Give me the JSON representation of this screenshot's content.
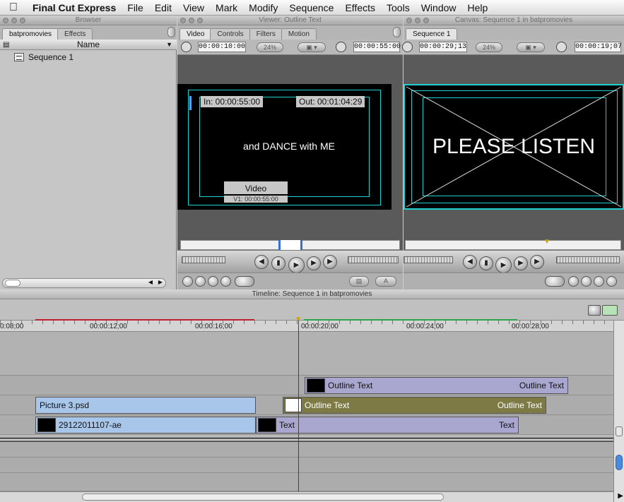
{
  "menubar": {
    "apple": "",
    "items": [
      "Final Cut Express",
      "File",
      "Edit",
      "View",
      "Mark",
      "Modify",
      "Sequence",
      "Effects",
      "Tools",
      "Window",
      "Help"
    ]
  },
  "browser": {
    "title": "Browser",
    "tabs": [
      "batpromovies",
      "Effects"
    ],
    "column_header": "Name",
    "items": [
      {
        "label": "Sequence 1"
      }
    ]
  },
  "viewer": {
    "title": "Viewer: Outline Text",
    "tabs": [
      "Video",
      "Controls",
      "Filters",
      "Motion"
    ],
    "duration_tc": "00:00:10:00",
    "zoom": "24%",
    "current_tc": "00:00:55:00",
    "in_label": "In: 00:00:55:00",
    "out_label": "Out: 00:01:04:29",
    "frame_text": "and DANCE with ME",
    "overlay_title": "Video",
    "overlay_sub": "V1: 00:00:55:00"
  },
  "canvas": {
    "title": "Canvas: Sequence 1 in batpromovies",
    "tabs": [
      "Sequence 1"
    ],
    "duration_tc": "00:00:29;13",
    "zoom": "24%",
    "current_tc": "00:00:19;07",
    "frame_text": "PLEASE LISTEN"
  },
  "timeline": {
    "title": "Timeline: Sequence 1 in batpromovies",
    "ruler": [
      "0:08;00",
      "00:00:12;00",
      "00:00:16;00",
      "00:00:20;00",
      "00:00:24;00",
      "00:00:28;00"
    ],
    "clips": {
      "v3_a": "Outline Text",
      "v3_b": "Outline Text",
      "v2_pic": "Picture 3.psd",
      "v2_a": "Outline Text",
      "v2_b": "Outline Text",
      "v1_movie": "29122011107-ae",
      "v1_text": "Text",
      "v1_text_end": "Text"
    }
  }
}
